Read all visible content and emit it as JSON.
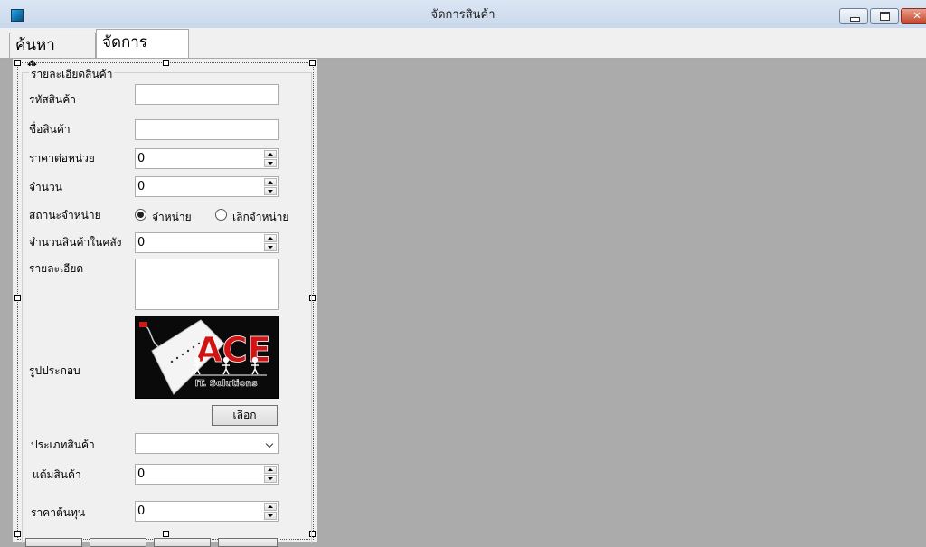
{
  "window": {
    "title": "จัดการสินค้า",
    "minimize_glyph": "",
    "close_glyph": "✕"
  },
  "tabs": [
    {
      "label": "ค้นหาสินค้า"
    },
    {
      "label": "จัดการสินค้า"
    }
  ],
  "form": {
    "group_title": "รายละเอียดสินค้า",
    "product_code_label": "รหัสสินค้า",
    "product_code_value": "",
    "product_name_label": "ชื่อสินค้า",
    "product_name_value": "",
    "unit_price_label": "ราคาต่อหน่วย",
    "unit_price_value": "0",
    "quantity_label": "จำนวน",
    "quantity_value": "0",
    "sale_status_label": "สถานะจำหน่าย",
    "status_options": [
      {
        "label": "จำหน่าย",
        "selected": true
      },
      {
        "label": "เลิกจำหน่าย",
        "selected": false
      }
    ],
    "stock_label": "จำนวนสินค้าในคลัง",
    "stock_value": "0",
    "details_label": "รายละเอียด",
    "details_value": "",
    "image_label": "รูปประกอบ",
    "image_logo_text": "ACE",
    "image_logo_subtext": "IT. Solutions",
    "choose_button": "เลือก",
    "category_label": "ประเภทสินค้า",
    "category_value": "",
    "points_label": "แต้มสินค้า",
    "points_value": "0",
    "cost_label": "ราคาต้นทุน",
    "cost_value": "0"
  },
  "colors": {
    "workspace": "#ababab",
    "panel": "#f0f0f0",
    "logo_red": "#d01414"
  }
}
